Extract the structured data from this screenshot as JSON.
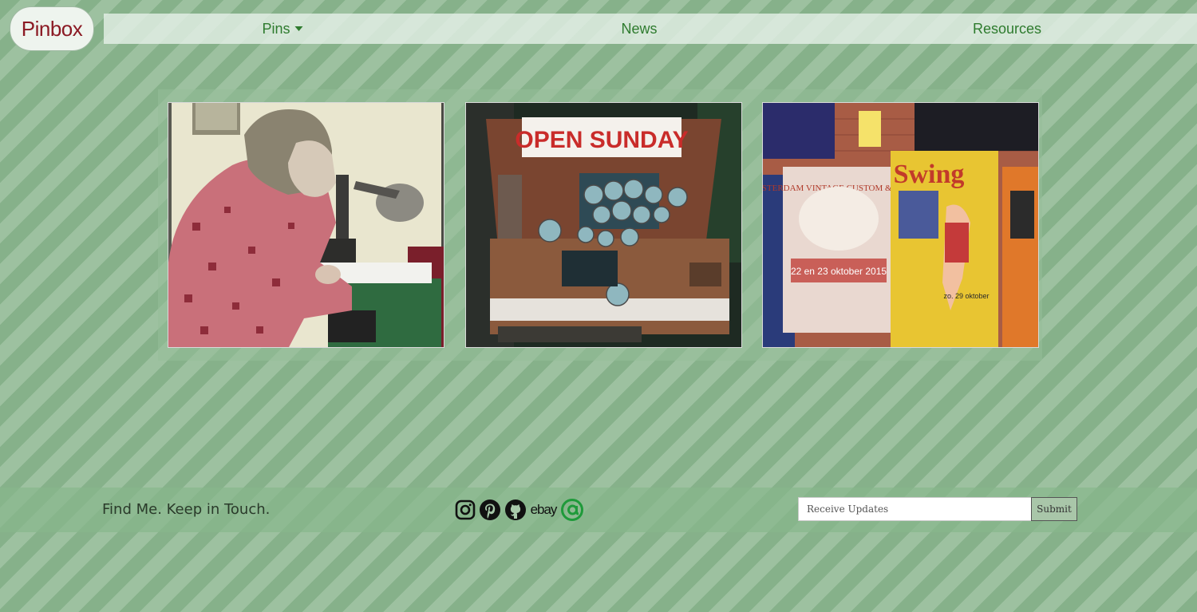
{
  "brand": {
    "logo_text": "Pinbox",
    "color": "#8b1a24"
  },
  "nav": {
    "items": [
      {
        "label": "Pins",
        "has_dropdown": true
      },
      {
        "label": "News",
        "has_dropdown": false
      },
      {
        "label": "Resources",
        "has_dropdown": false
      }
    ],
    "link_color": "#2e7b2e"
  },
  "gallery": {
    "photos": [
      {
        "name": "woman-microscope-photo"
      },
      {
        "name": "open-sunday-suitcase-photo",
        "sign_text": "OPEN SUNDAY"
      },
      {
        "name": "posters-wall-photo",
        "poster_texts": [
          "Swing",
          "THE AMSTERDAM VINTAGE CUSTOM & DRUM SHOW",
          "22 en 23 oktober 2015",
          "zo. 29 oktober"
        ]
      }
    ]
  },
  "footer": {
    "tagline": "Find Me. Keep in Touch.",
    "social_icons": [
      "instagram-icon",
      "pinterest-icon",
      "github-icon",
      "ebay-icon",
      "email-at-icon"
    ],
    "ebay_text": "ebay",
    "email_placeholder": "Receive Updates",
    "submit_label": "Submit"
  },
  "colors": {
    "background": "#86b18a",
    "stripe": "#9dc1a0",
    "accent_green": "#2e7b2e"
  }
}
